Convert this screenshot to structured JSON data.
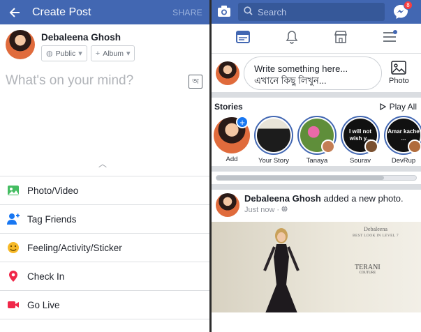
{
  "left": {
    "header": {
      "title": "Create Post",
      "share": "SHARE"
    },
    "user": {
      "name": "Debaleena Ghosh",
      "privacy": "Public",
      "album": "Album"
    },
    "compose": {
      "placeholder": "What's on your mind?",
      "lang_glyph": "অ"
    },
    "actions": [
      {
        "label": "Photo/Video",
        "icon": "photo-icon"
      },
      {
        "label": "Tag Friends",
        "icon": "tag-friends-icon"
      },
      {
        "label": "Feeling/Activity/Sticker",
        "icon": "feeling-icon"
      },
      {
        "label": "Check In",
        "icon": "check-in-icon"
      },
      {
        "label": "Go Live",
        "icon": "go-live-icon"
      }
    ]
  },
  "right": {
    "header": {
      "search_placeholder": "Search",
      "messenger_badge": "8"
    },
    "composer": {
      "line1": "Write something here...",
      "line2": "এখানে কিছু লিখুন...",
      "photo": "Photo"
    },
    "stories": {
      "title": "Stories",
      "play_all": "Play All",
      "items": [
        {
          "label": "Add"
        },
        {
          "label": "Your Story"
        },
        {
          "label": "Tanaya"
        },
        {
          "label": "Sourav",
          "thumb_text": "I will not wish y..."
        },
        {
          "label": "DevRup",
          "thumb_text": "Amar kache ..."
        }
      ]
    },
    "post": {
      "author": "Debaleena Ghosh",
      "action": "added a new photo.",
      "time": "Just now",
      "image_text": {
        "name": "Debaleena",
        "sub": "BEST LOOK IN LEVEL 7",
        "brand": "TERANI",
        "brand_sub": "COUTURE"
      }
    }
  },
  "colors": {
    "brand_blue": "#4267b2",
    "badge_red": "#fa3e3e",
    "divider": "#dadde1"
  }
}
